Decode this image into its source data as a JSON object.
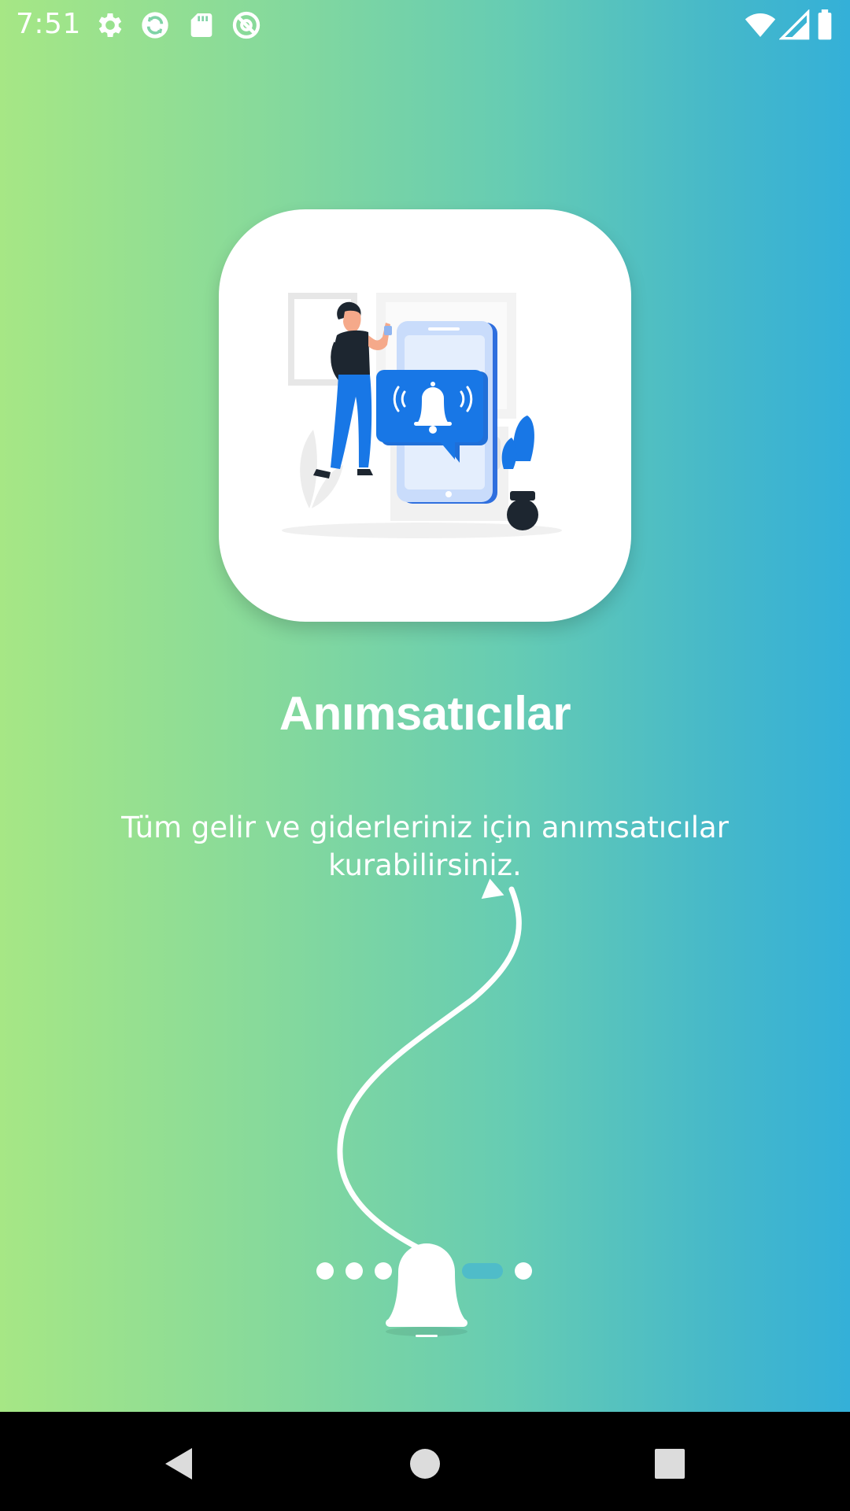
{
  "status_bar": {
    "time": "7:51",
    "left_icons": [
      "gear-icon",
      "sync-icon",
      "sd-card-icon",
      "at-sign-icon"
    ],
    "right_icons": [
      "wifi-icon",
      "cell-signal-icon",
      "battery-icon"
    ]
  },
  "onboarding": {
    "title": "Anımsatıcılar",
    "description": "Tüm gelir ve giderleriniz için anımsatıcılar kurabilirsiniz.",
    "illustration": "person-phone-notification-bell",
    "page_indicator": {
      "total": 5,
      "active_index": 3
    },
    "bell_icon": "bell-icon"
  },
  "colors": {
    "gradient_start": "#a6e785",
    "gradient_end": "#34b0d8",
    "accent_blue": "#1877e6",
    "active_dot": "#4fbcc9"
  },
  "nav_bar": {
    "buttons": [
      "back-icon",
      "home-icon",
      "recents-icon"
    ]
  }
}
